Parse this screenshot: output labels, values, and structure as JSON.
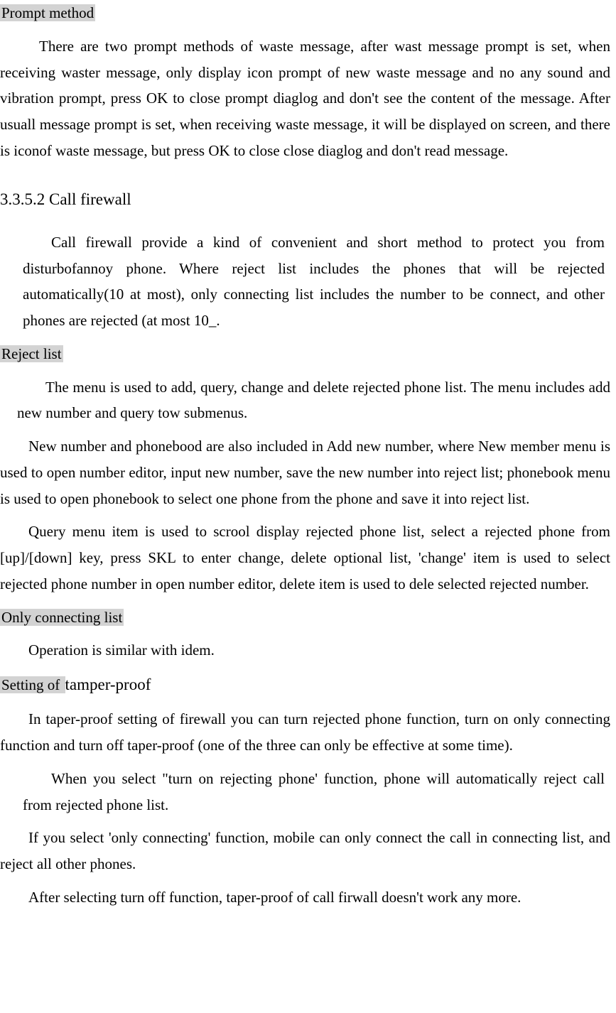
{
  "headings": {
    "prompt_method": "Prompt method  ",
    "call_firewall": "3.3.5.2 Call firewall",
    "reject_list": "Reject list  ",
    "only_connecting_list": "Only connecting list",
    "setting_of": "Setting of ",
    "tamper_proof": "tamper-proof"
  },
  "paragraphs": {
    "p1": "There are two prompt methods of waste message, after wast message prompt is set, when receiving waster message, only display icon prompt of new waste message and no any sound and vibration prompt, press OK to close prompt diaglog and don't see the content of the message. After usuall message prompt is set, when receiving waste message, it will be displayed on screen, and there is iconof waste message, but press OK to close close diaglog and don't read message.",
    "p2": "Call firewall provide a kind of convenient and short method to protect you from disturbofannoy phone. Where reject list includes the phones that will be rejected automatically(10 at most), only connecting list includes the number to be connect, and other phones are rejected (at most 10_.",
    "p3": "The menu is used to add, query, change and delete rejected phone list. The menu includes add new number and query tow submenus.",
    "p4": "New number and phonebood are also included in Add new number, where New member menu is used to open number editor, input new number, save the new number into reject list; phonebook menu is used to open phonebook to select one phone from the phone and save it into reject list.",
    "p5": "Query menu item is used to scrool display rejected phone list, select a rejected phone from [up]/[down] key, press SKL to enter change, delete optional list, 'change' item is used to select rejected phone number in open number editor, delete item is used to dele selected rejected number.",
    "p6": "Operation is similar with idem.",
    "p7": "In taper-proof setting of firewall you can turn rejected phone function, turn on only connecting function and turn off taper-proof (one of the three can only be effective at some time).",
    "p8": "When you select \"turn on rejecting phone' function, phone will automatically reject call from rejected phone list.",
    "p9": "If you select 'only connecting' function, mobile can only connect the call in connecting list, and reject all other phones.",
    "p10": "After selecting turn off function, taper-proof of call firwall doesn't work any more."
  }
}
